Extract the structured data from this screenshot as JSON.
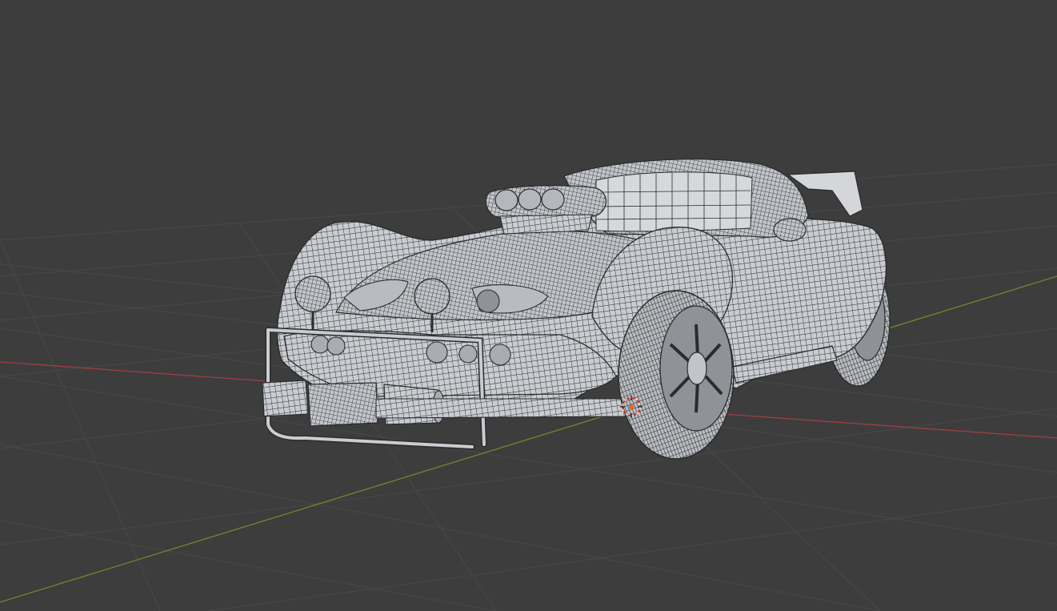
{
  "viewport": {
    "background": "#3d3d3d",
    "grid_color": "#474747",
    "x_axis_color": "#a13e45",
    "y_axis_color": "#6b8a2e"
  },
  "scene": {
    "object": "car-mesh",
    "display_mode": "wireframe",
    "body_color": "#c9ccd0",
    "wire_color": "#2a2c2e",
    "origin_marker_color": "#e8631a",
    "cursor_icon": "3d-cursor-icon"
  }
}
